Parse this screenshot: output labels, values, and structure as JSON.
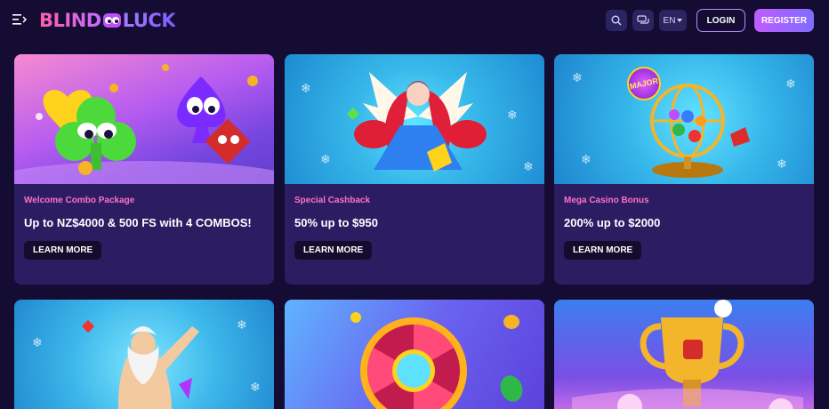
{
  "header": {
    "logo_left": "BLIND",
    "logo_right": "LUCK",
    "lang": "EN",
    "login": "LOGIN",
    "register": "REGISTER"
  },
  "promotions": [
    {
      "tag": "Welcome Combo Package",
      "title": "Up to NZ$4000 & 500 FS with 4 COMBOS!",
      "button": "LEARN MORE"
    },
    {
      "tag": "Special Cashback",
      "title": "50% up to $950",
      "button": "LEARN MORE"
    },
    {
      "tag": "Mega Casino Bonus",
      "title": "200% up to $2000",
      "button": "LEARN MORE"
    }
  ],
  "images": {
    "card1": "cartoon-suit-characters",
    "card2": "anime-angel-girl",
    "card3": "golden-lottery-cage-major",
    "card4": "zeus-god",
    "card5": "prize-wheel",
    "card6": "golden-trophy-footballs"
  },
  "badge_major": "MAJOR",
  "colors": {
    "background": "#150c33",
    "card": "#2c1d63",
    "tag": "#ff6fc5",
    "accent": "#b48cff"
  }
}
